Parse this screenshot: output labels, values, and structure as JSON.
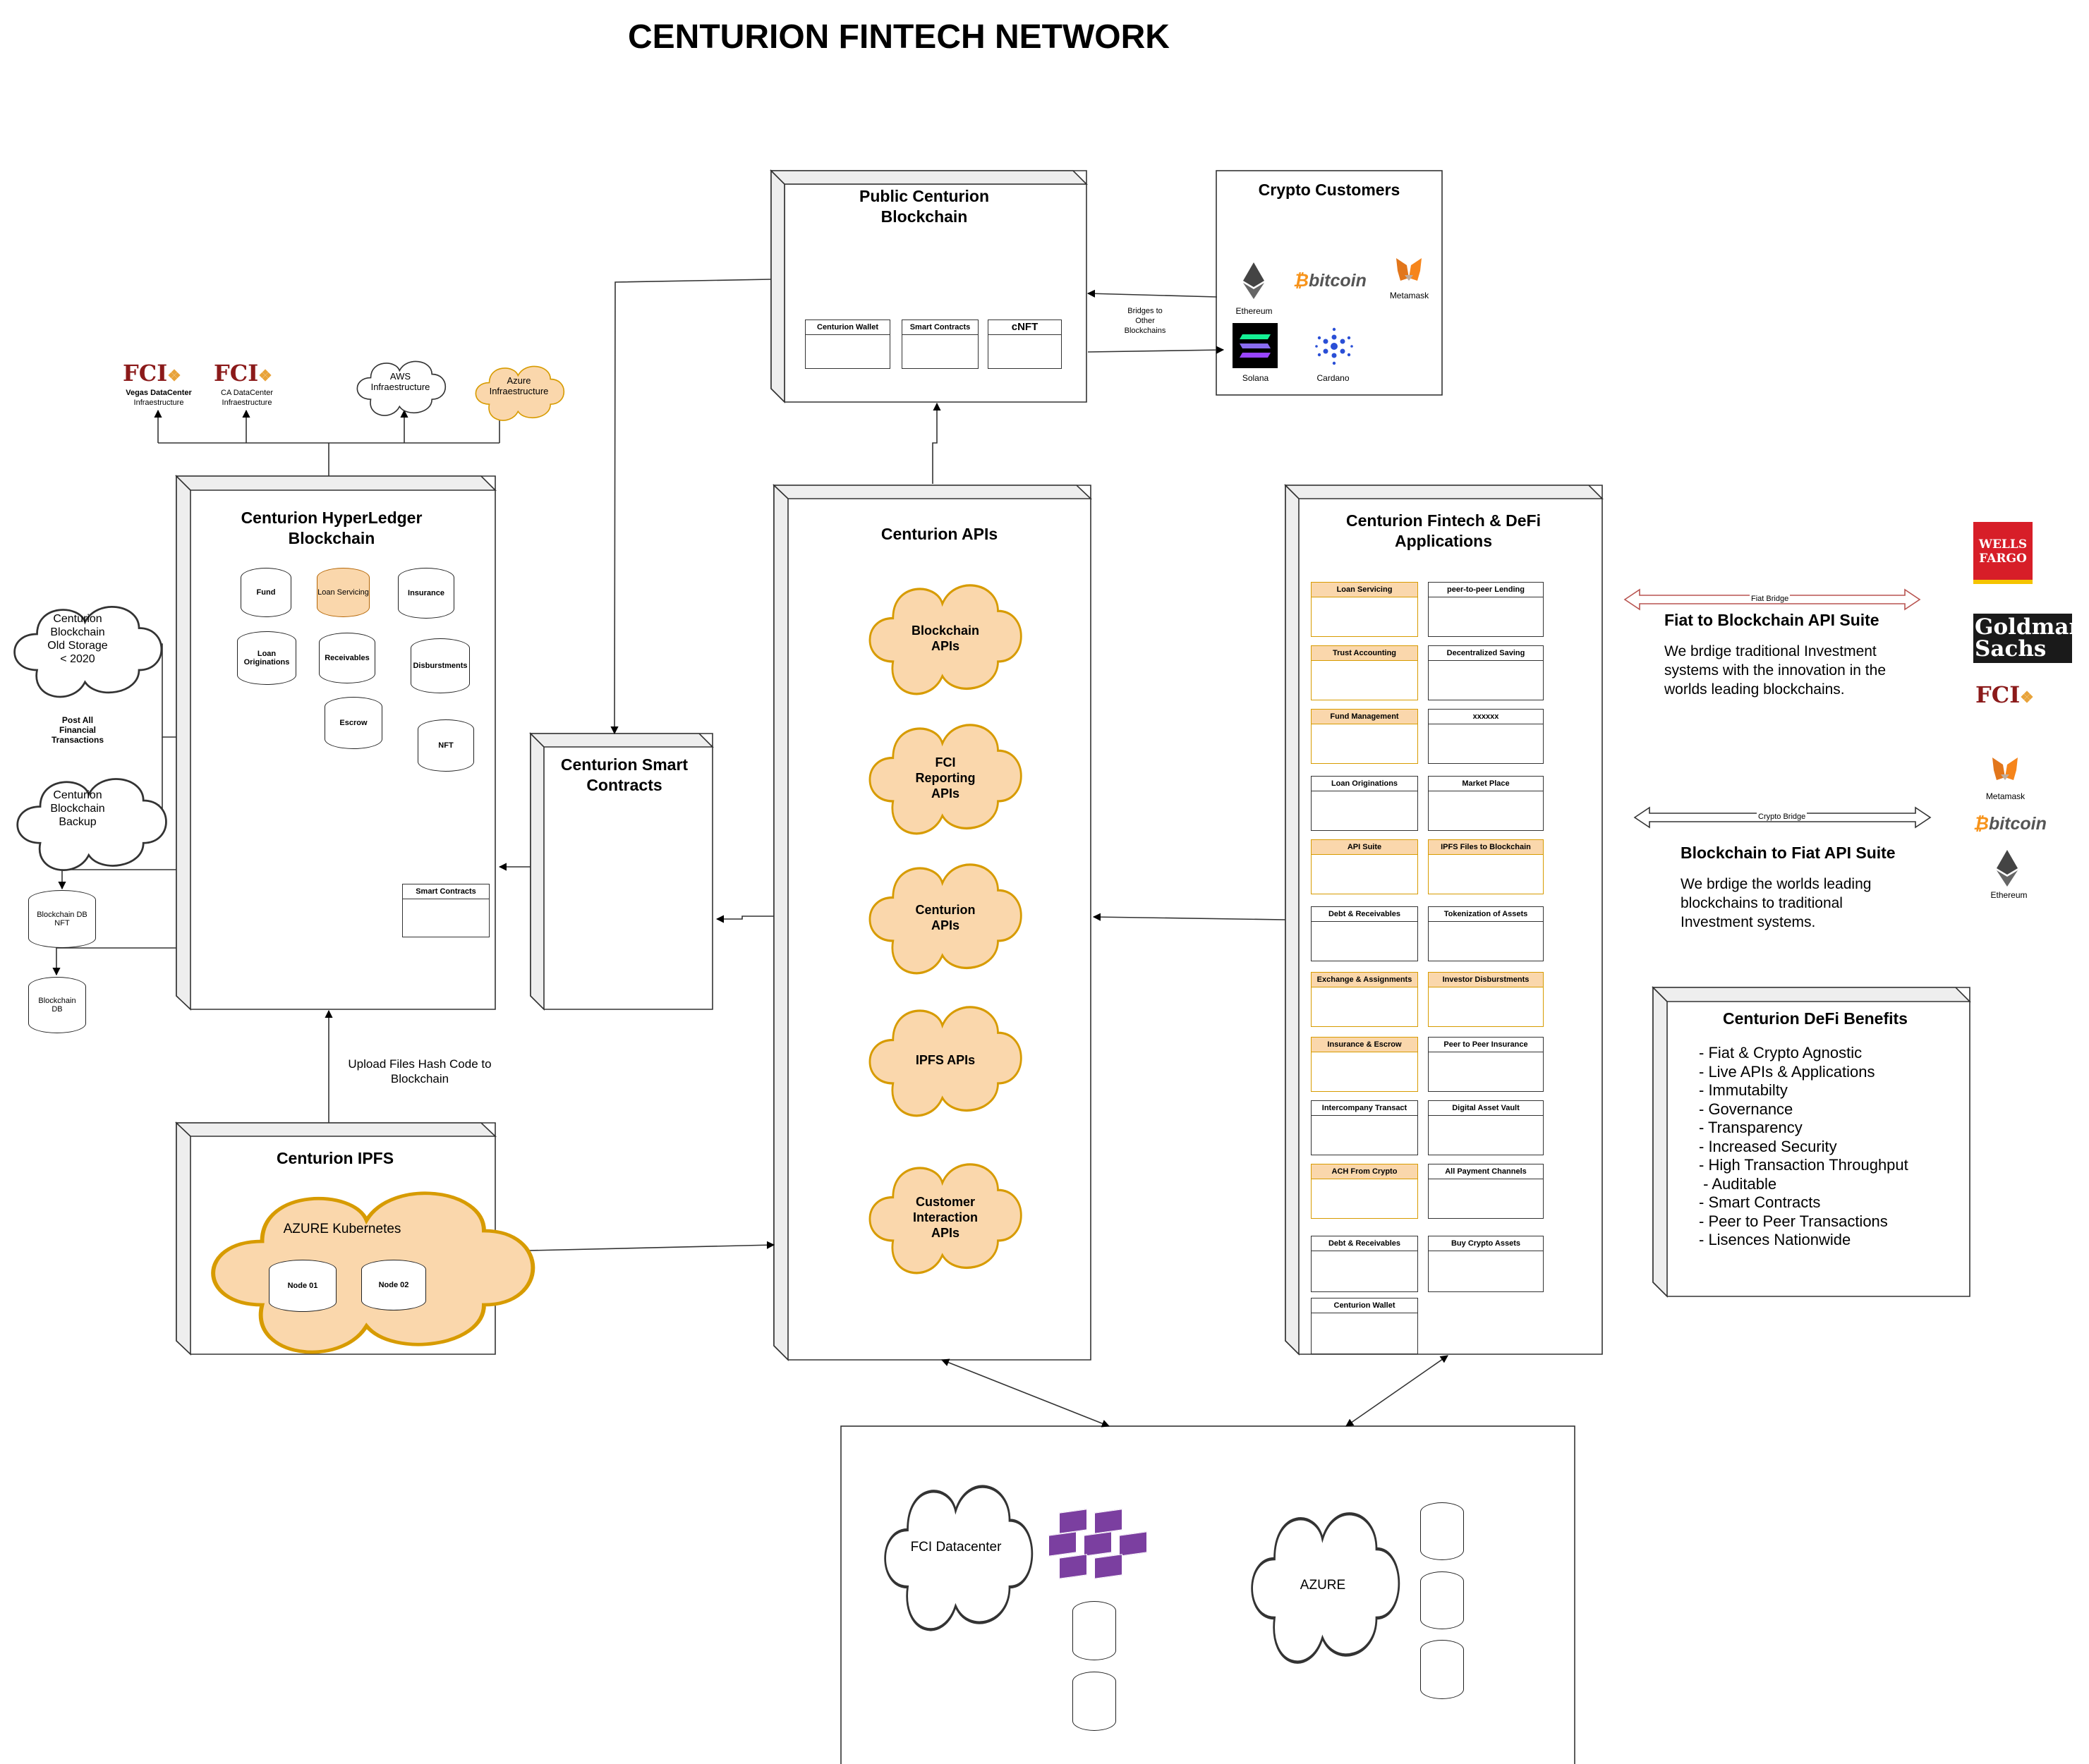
{
  "page": {
    "title": "CENTURION FINTECH NETWORK"
  },
  "colors": {
    "accent_fill": "#fad7ac",
    "accent_stroke": "#d79b00",
    "wells_red": "#d71e28",
    "goldman_bg": "#1a1a1a",
    "fci_red": "#8b1a1a",
    "azure_purple": "#7b3fa0"
  },
  "public_blockchain": {
    "title_line1": "Public Centurion",
    "title_line2": "Blockchain",
    "boxes": [
      "Centurion Wallet",
      "Smart Contracts",
      "cNFT"
    ],
    "bridge_label": [
      "Bridges to",
      "Other",
      "Blockchains"
    ]
  },
  "crypto_customers": {
    "title": "Crypto Customers",
    "items": [
      {
        "name": "Ethereum",
        "icon": "ethereum-icon"
      },
      {
        "name": "bitcoin",
        "icon": "bitcoin-icon"
      },
      {
        "name": "Metamask",
        "icon": "metamask-fox-icon"
      },
      {
        "name": "Solana",
        "icon": "solana-icon"
      },
      {
        "name": "Cardano",
        "icon": "cardano-icon"
      }
    ]
  },
  "infra": {
    "fci_logo": "FCI",
    "vegas": [
      "Vegas DataCenter",
      "Infraestructure"
    ],
    "ca": [
      "CA DataCenter",
      "Infraestructure"
    ],
    "aws": [
      "AWS",
      "Infraestructure"
    ],
    "azure": [
      "Azure",
      "Infraestructure"
    ]
  },
  "hyperledger": {
    "title_line1": "Centurion HyperLedger",
    "title_line2": "Blockchain",
    "stores": [
      "Fund",
      "Loan Servicing",
      "Insurance",
      "Loan Originations",
      "Receivables",
      "Disburstments",
      "Escrow",
      "NFT"
    ],
    "smart_contracts": "Smart Contracts"
  },
  "storage": {
    "old_storage": [
      "Centurion",
      "Blockchain",
      "Old Storage",
      "< 2020"
    ],
    "post_label": [
      "Post All",
      "Financial",
      "Transactions"
    ],
    "backup": [
      "Centurion",
      "Blockchain",
      "Backup"
    ],
    "db_nft": [
      "Blockchain DB",
      "NFT"
    ],
    "db": [
      "Blockchain",
      "DB"
    ]
  },
  "smart_contracts": {
    "title_line1": "Centurion Smart",
    "title_line2": "Contracts"
  },
  "ipfs": {
    "upload_label": [
      "Upload Files Hash Code to",
      "Blockchain"
    ],
    "title": "Centurion IPFS",
    "kubernetes": "AZURE Kubernetes",
    "nodes": [
      "Node 01",
      "Node 02"
    ]
  },
  "apis": {
    "title": "Centurion APIs",
    "items": [
      [
        "Blockchain",
        "APIs"
      ],
      [
        "FCI",
        "Reporting",
        "APIs"
      ],
      [
        "Centurion",
        "APIs"
      ],
      [
        "IPFS APIs"
      ],
      [
        "Customer",
        "Interaction",
        "APIs"
      ]
    ]
  },
  "apps": {
    "title_line1": "Centurion Fintech & DeFi",
    "title_line2": "Applications",
    "items": [
      "Loan Servicing",
      "peer-to-peer Lending",
      "Trust Accounting",
      "Decentralized Saving",
      "Fund Management",
      "xxxxxx",
      "Loan Originations",
      "Market Place",
      "API Suite",
      "IPFS Files to Blockchain",
      "Debt & Receivables",
      "Tokenization of Assets",
      "Exchange & Assignments",
      "Investor Disburstments",
      "Insurance & Escrow",
      "Peer to Peer Insurance",
      "Intercompany Transact",
      "Digital Asset Vault",
      "ACH From Crypto",
      "All Payment Channels",
      "Debt & Receivables",
      "Buy Crypto Assets",
      "Centurion Wallet"
    ]
  },
  "fiat_suite": {
    "bridge_label": "Fiat Bridge",
    "title": "Fiat to Blockchain API Suite",
    "body": [
      "We brdige traditional Investment",
      "systems with the innovation in the",
      "worlds leading blockchains."
    ]
  },
  "crypto_suite": {
    "bridge_label": "Crypto Bridge",
    "title": "Blockchain to Fiat API Suite",
    "body": [
      "We brdige the worlds leading",
      "blockchains to traditional",
      "Investment systems."
    ]
  },
  "logos": {
    "wells": [
      "WELLS",
      "FARGO"
    ],
    "goldman": [
      "Goldman",
      "Sachs"
    ],
    "fci": "FCI",
    "metamask": "Metamask",
    "bitcoin": "bitcoin",
    "ethereum": "Ethereum"
  },
  "benefits": {
    "title": "Centurion DeFi Benefits",
    "items": [
      "- Fiat & Crypto Agnostic",
      "- Live APIs & Applications",
      "- Immutabilty",
      "- Governance",
      "- Transparency",
      "- Increased Security",
      "- High Transaction Throughput",
      " - Auditable",
      "- Smart Contracts",
      "- Peer to Peer Transactions",
      "- Lisences Nationwide"
    ]
  },
  "datacenter": {
    "fci": "FCI Datacenter",
    "azure": "AZURE"
  }
}
